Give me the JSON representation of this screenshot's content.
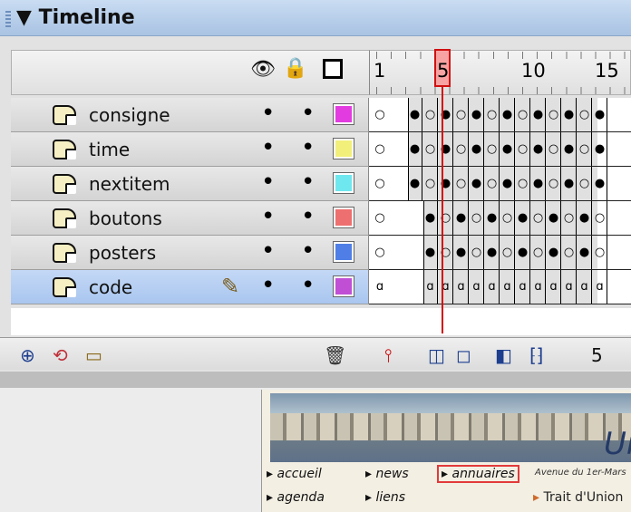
{
  "panel": {
    "title": "▼ Timeline",
    "header_icons": [
      "eye-icon",
      "lock-icon",
      "outline-icon"
    ],
    "frame_numbers": [
      "1",
      "5",
      "10",
      "15"
    ],
    "current_frame": 5,
    "frame_count_label": "5"
  },
  "layers": [
    {
      "name": "consigne",
      "color": "#e23ce0",
      "selected": false
    },
    {
      "name": "time",
      "color": "#f2f07a",
      "selected": false
    },
    {
      "name": "nextitem",
      "color": "#6fe7ee",
      "selected": false
    },
    {
      "name": "boutons",
      "color": "#ee6f6f",
      "selected": false
    },
    {
      "name": "posters",
      "color": "#4f7fe6",
      "selected": false
    },
    {
      "name": "code",
      "color": "#c04fd6",
      "selected": true
    }
  ],
  "bottom_toolbar": {
    "icons": [
      "add-layer-icon",
      "add-motion-guide-icon",
      "add-folder-icon",
      "trash-icon",
      "center-frame-icon",
      "onion-skin-icon",
      "onion-outlines-icon",
      "edit-multiple-icon",
      "modify-markers-icon"
    ]
  },
  "stage": {
    "brand": "Ur",
    "nav": [
      "accueil",
      "news",
      "annuaires",
      "agenda",
      "liens"
    ],
    "address": "Avenue du 1er-Mars",
    "trait": "Trait d'Union"
  }
}
